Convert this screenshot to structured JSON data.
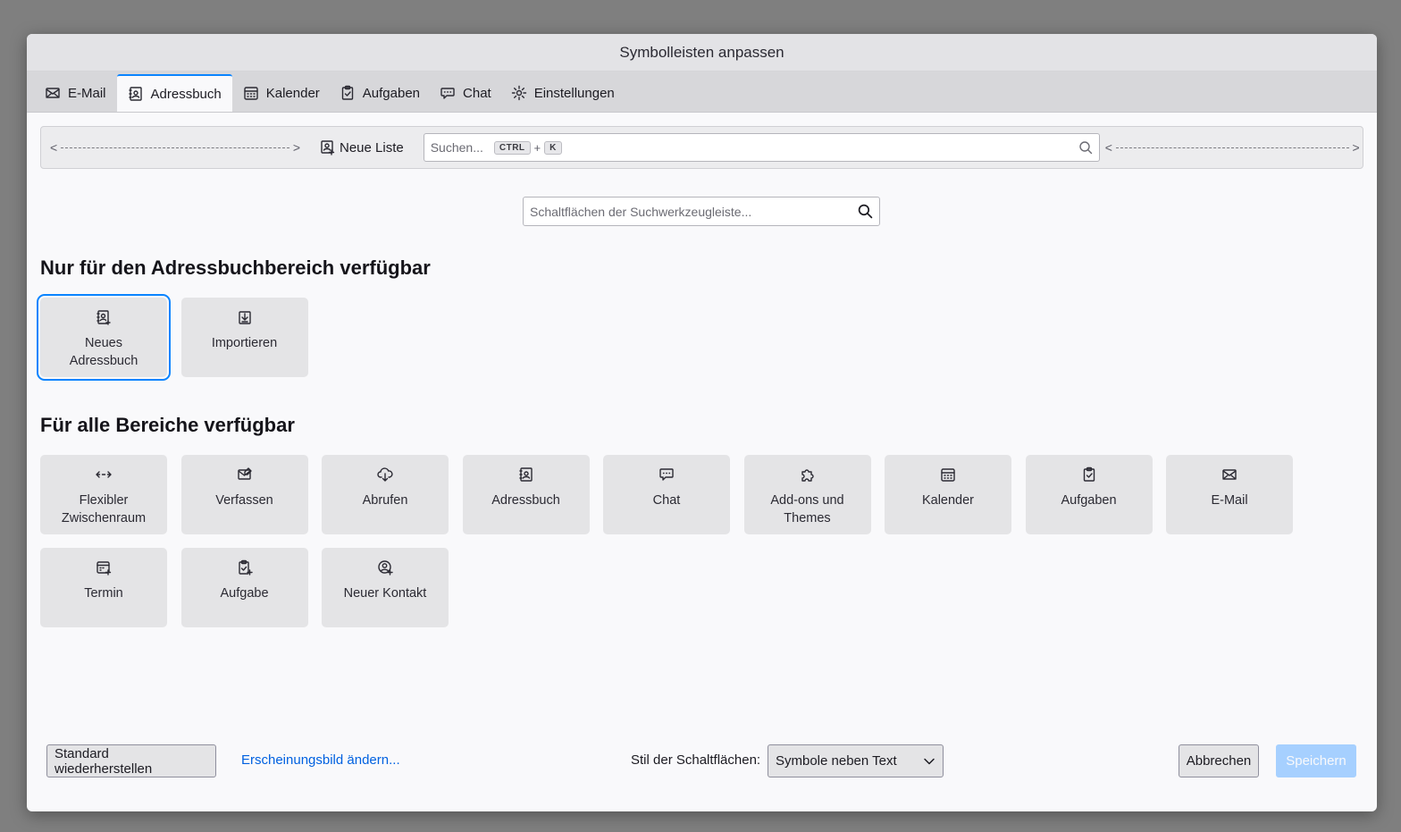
{
  "title": "Symbolleisten anpassen",
  "tabs": [
    {
      "label": "E-Mail",
      "icon": "mail-icon"
    },
    {
      "label": "Adressbuch",
      "icon": "addressbook-icon",
      "active": true
    },
    {
      "label": "Kalender",
      "icon": "calendar-icon"
    },
    {
      "label": "Aufgaben",
      "icon": "tasks-icon"
    },
    {
      "label": "Chat",
      "icon": "chat-icon"
    },
    {
      "label": "Einstellungen",
      "icon": "gear-icon"
    }
  ],
  "toolbar": {
    "new_list_label": "Neue Liste",
    "search_placeholder": "Suchen...",
    "shortcut_key1": "CTRL",
    "shortcut_plus": "+",
    "shortcut_key2": "K"
  },
  "palette_search": {
    "placeholder": "Schaltflächen der Suchwerkzeugleiste..."
  },
  "section_addressbook": {
    "heading": "Nur für den Adressbuchbereich verfügbar",
    "items": [
      {
        "label": "Neues Adressbuch",
        "icon": "new-addressbook-icon"
      },
      {
        "label": "Importieren",
        "icon": "import-icon"
      }
    ]
  },
  "section_all": {
    "heading": "Für alle Bereiche verfügbar",
    "items": [
      {
        "label": "Flexibler Zwischenraum",
        "icon": "flexible-space-icon"
      },
      {
        "label": "Verfassen",
        "icon": "compose-icon"
      },
      {
        "label": "Abrufen",
        "icon": "get-messages-icon"
      },
      {
        "label": "Adressbuch",
        "icon": "addressbook-icon"
      },
      {
        "label": "Chat",
        "icon": "chat-icon"
      },
      {
        "label": "Add-ons und Themes",
        "icon": "puzzle-icon"
      },
      {
        "label": "Kalender",
        "icon": "calendar-icon"
      },
      {
        "label": "Aufgaben",
        "icon": "tasks-icon"
      },
      {
        "label": "E-Mail",
        "icon": "mail-icon"
      },
      {
        "label": "Termin",
        "icon": "new-event-icon"
      },
      {
        "label": "Aufgabe",
        "icon": "new-task-icon"
      },
      {
        "label": "Neuer Kontakt",
        "icon": "new-contact-icon"
      }
    ]
  },
  "footer": {
    "restore_label": "Standard wiederherstellen",
    "appearance_link": "Erscheinungsbild ändern...",
    "style_label": "Stil der Schaltflächen:",
    "style_value": "Symbole neben Text",
    "cancel_label": "Abbrechen",
    "save_label": "Speichern"
  }
}
